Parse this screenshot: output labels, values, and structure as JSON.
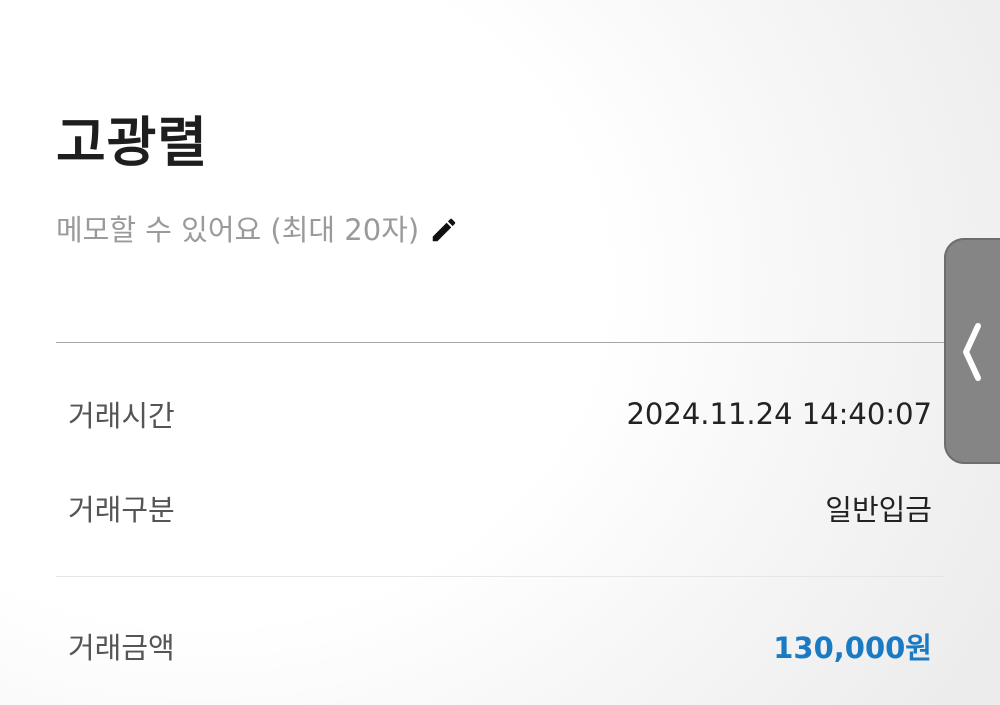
{
  "header": {
    "title": "고광렬",
    "memo_placeholder": "메모할 수 있어요 (최대 20자)"
  },
  "details": [
    {
      "label": "거래시간",
      "value": "2024.11.24 14:40:07"
    },
    {
      "label": "거래구분",
      "value": "일반입금"
    },
    {
      "label": "거래금액",
      "value": "130,000원"
    }
  ],
  "icons": {
    "memo_edit": "pencil-icon",
    "side_handle": "chevron-left-icon"
  },
  "colors": {
    "amount": "#1a7bc2",
    "title": "#1e1e1e",
    "placeholder": "#9a9a9a"
  }
}
